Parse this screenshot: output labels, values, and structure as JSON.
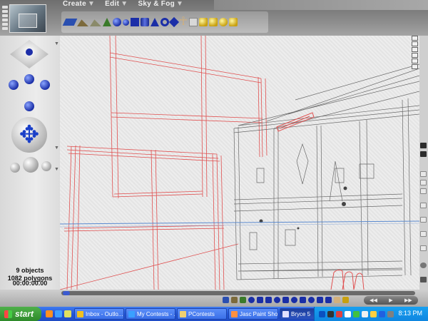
{
  "menu": {
    "items": [
      {
        "label": "Create",
        "icon": "chevron-down-icon"
      },
      {
        "label": "Edit",
        "icon": "chevron-down-icon"
      },
      {
        "label": "Sky & Fog",
        "icon": "chevron-down-icon"
      }
    ]
  },
  "palette": {
    "icons": [
      "plane-icon",
      "terrain-icon",
      "stone-icon",
      "tree-icon",
      "sphere-icon",
      "cube-icon",
      "cylinder-icon",
      "cone-icon",
      "torus-icon",
      "human-figure-icon",
      "symmetric-lattice-icon",
      "gold-primitive-icon"
    ]
  },
  "status": {
    "objects": "9 objects",
    "polygons": "1082 polygons",
    "time": "00:00:00.00"
  },
  "taskbar": {
    "start_label": "start",
    "tasks": [
      {
        "label": "Inbox - Outlo...",
        "icon": "mail-icon",
        "color": "#f0c020"
      },
      {
        "label": "My Contests - ...",
        "icon": "browser-icon",
        "color": "#3aa0ff"
      },
      {
        "label": "PContests",
        "icon": "folder-icon",
        "color": "#f0d070"
      },
      {
        "label": "Jasc Paint Sho...",
        "icon": "paint-icon",
        "color": "#ff9040"
      },
      {
        "label": "Bryce 5",
        "icon": "bryce-icon",
        "color": "#e0e0ff"
      }
    ],
    "clock": "8:13 PM"
  },
  "colors": {
    "accent_blue": "#1a2ea6",
    "wireframe_red": "#e05050",
    "wireframe_gray": "#6a6a6a",
    "taskbar_blue": "#2456d8",
    "start_green": "#2e8a2a"
  }
}
